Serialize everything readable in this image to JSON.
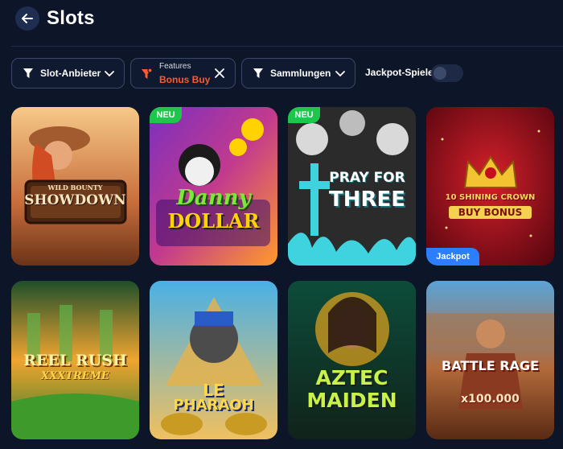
{
  "header": {
    "title": "Slots"
  },
  "filters": {
    "provider_label": "Slot-Anbieter",
    "features_small": "Features",
    "features_selected": "Bonus Buy",
    "collections_label": "Sammlungen",
    "jackpot_label": "Jackpot-Spiele",
    "jackpot_on": false
  },
  "colors": {
    "accent": "#ff5a2b",
    "new_badge": "#1ec64c",
    "jackpot_badge": "#2b7fff",
    "background": "#0d1528"
  },
  "games": [
    {
      "title_line1": "WILD BOUNTY",
      "title_line2": "SHOWDOWN",
      "badge": ""
    },
    {
      "title_line1": "Danny",
      "title_line2": "DOLLAR",
      "badge": "NEU"
    },
    {
      "title_line1": "PRAY FOR",
      "title_line2": "THREE",
      "badge": "NEU"
    },
    {
      "title_line1": "10 SHINING CROWN",
      "title_line2": "BUY BONUS",
      "badge": "Jackpot"
    },
    {
      "title_line1": "REEL RUSH",
      "title_line2": "XXXTREME",
      "badge": ""
    },
    {
      "title_line1": "LE",
      "title_line2": "PHARAOH",
      "badge": ""
    },
    {
      "title_line1": "AZTEC",
      "title_line2": "MAIDEN",
      "badge": ""
    },
    {
      "title_line1": "BATTLE RAGE",
      "title_line2": "x100.000",
      "badge": ""
    }
  ]
}
